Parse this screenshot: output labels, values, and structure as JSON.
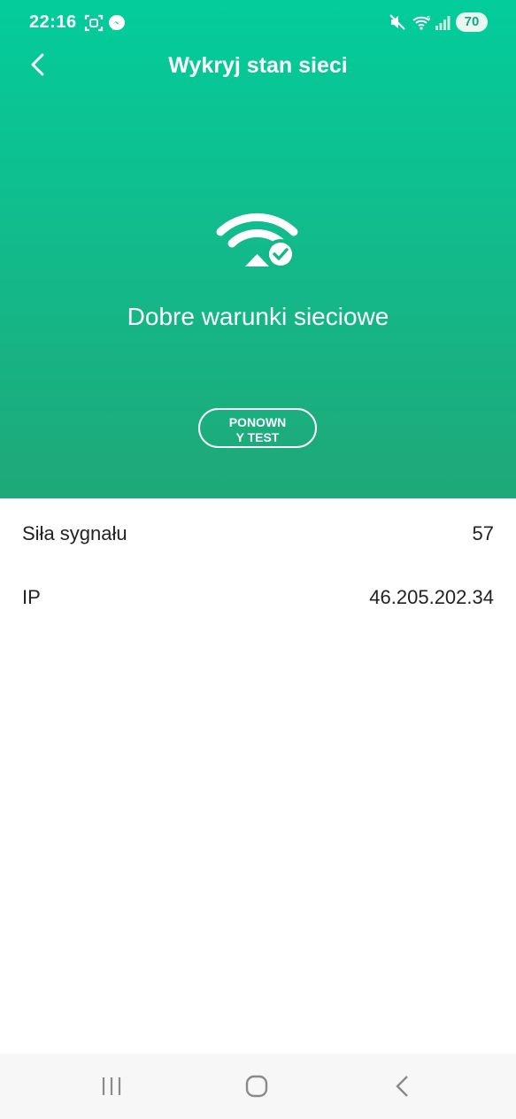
{
  "status_bar": {
    "time": "22:16",
    "battery": "70",
    "icons": [
      "screenshot-icon",
      "messenger-icon",
      "mute-icon",
      "wifi-icon",
      "signal-icon"
    ]
  },
  "header": {
    "title": "Wykryj stan sieci",
    "back_icon": "chevron-left-icon"
  },
  "hero": {
    "icon": "wifi-check-icon",
    "status": "Dobre warunki sieciowe",
    "retest_label": "PONOWNY TEST",
    "colors": {
      "top": "#03cc9b",
      "bottom": "#1fa878"
    }
  },
  "info": {
    "rows": [
      {
        "label": "Siła sygnału",
        "value": "57"
      },
      {
        "label": "IP",
        "value": "46.205.202.34"
      }
    ]
  },
  "nav": {
    "buttons": [
      "recent-apps-icon",
      "home-icon",
      "back-icon"
    ]
  }
}
